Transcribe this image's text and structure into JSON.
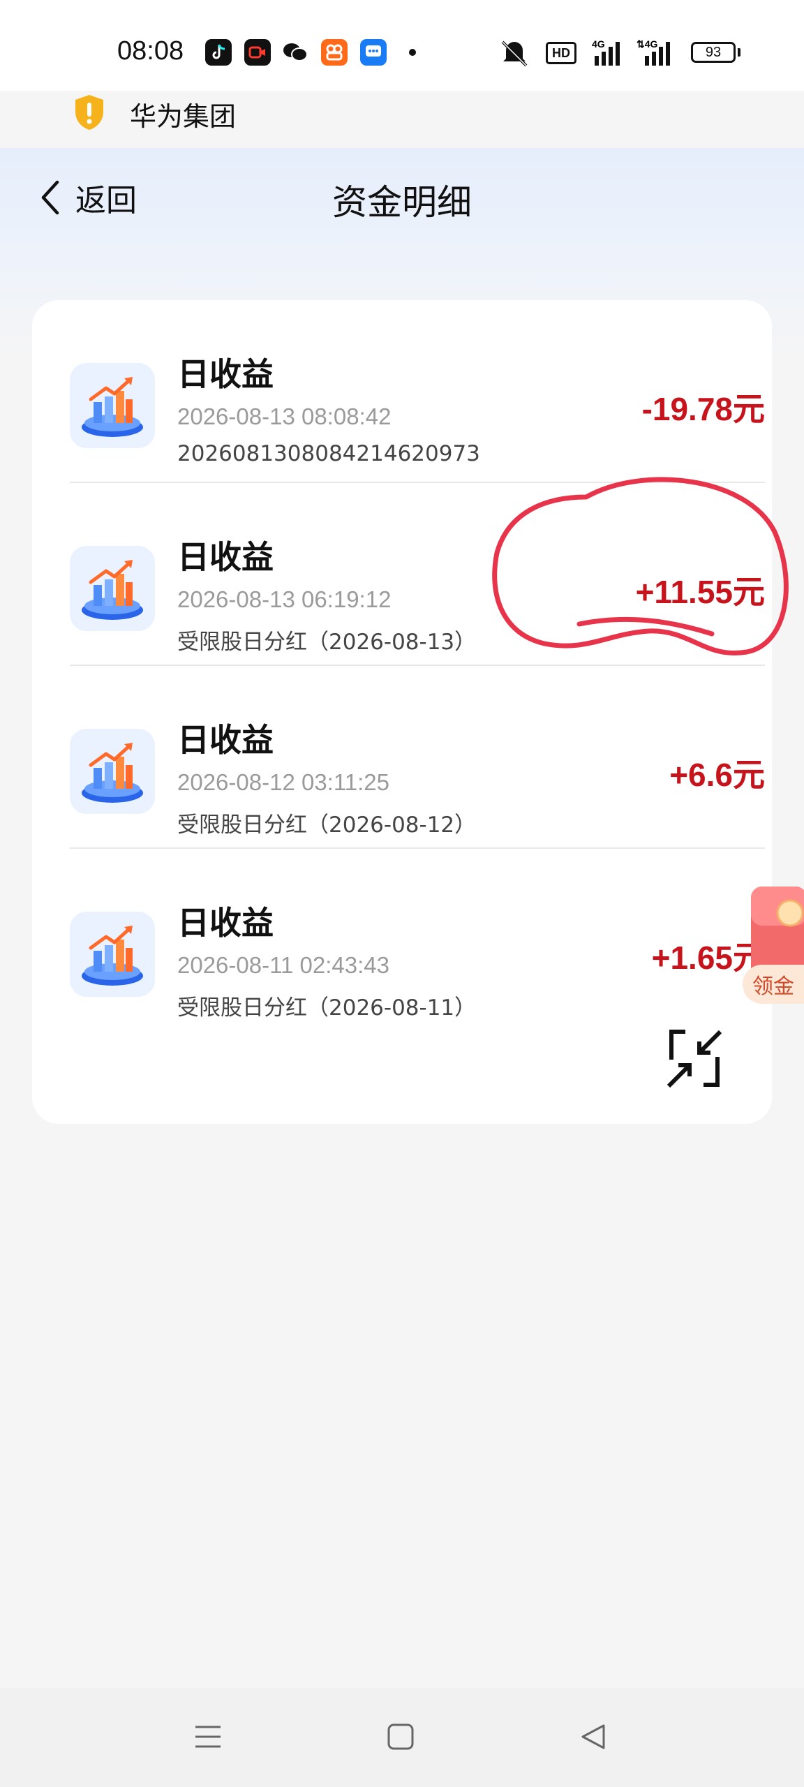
{
  "status_bar": {
    "time": "08:08",
    "network": "HD",
    "battery": "93",
    "icons": [
      "tiktok-icon",
      "video-icon",
      "wechat-icon",
      "app-icon",
      "message-icon",
      "mute-icon",
      "signal-4g-icon",
      "signal-4g-icon"
    ]
  },
  "notice": {
    "text": "华为集团"
  },
  "header": {
    "back_label": "返回",
    "title": "资金明细"
  },
  "transactions": [
    {
      "title": "日收益",
      "time": "2026-08-13 08:08:42",
      "desc": "20260813080842146209​73",
      "amount": "-19.78元"
    },
    {
      "title": "日收益",
      "time": "2026-08-13 06:19:12",
      "desc": "受限股日分红（2026-08-13）",
      "amount": "+11.55元"
    },
    {
      "title": "日收益",
      "time": "2026-08-12 03:11:25",
      "desc": "受限股日分红（2026-08-12）",
      "amount": "+6.6元"
    },
    {
      "title": "日收益",
      "time": "2026-08-11 02:43:43",
      "desc": "受限股日分红（2026-08-11）",
      "amount": "+1.65元"
    }
  ],
  "floating": {
    "label": "领金"
  },
  "colors": {
    "amount": "#c7141c",
    "annotation": "#e8344a"
  }
}
